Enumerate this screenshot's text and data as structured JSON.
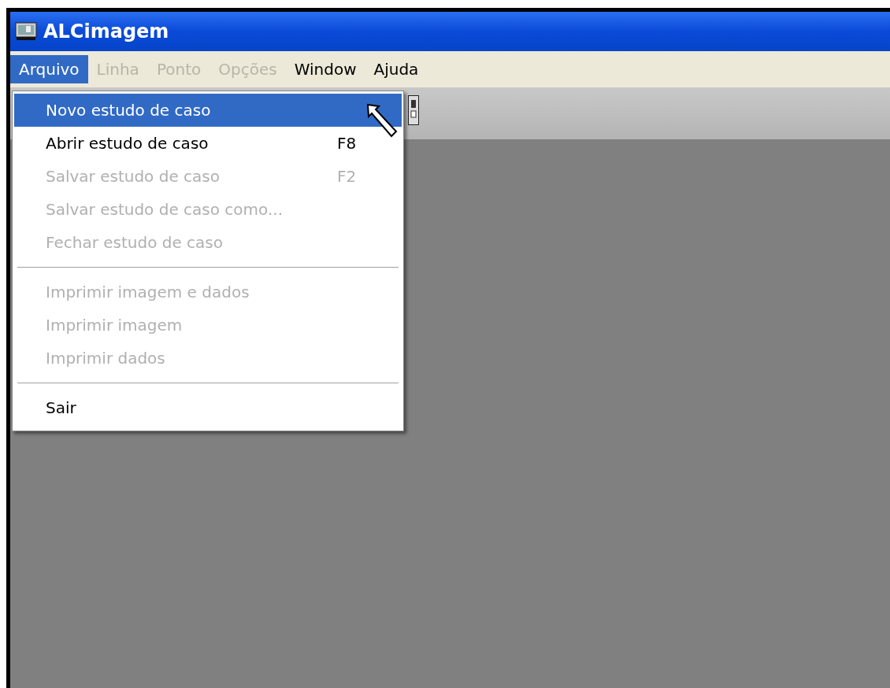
{
  "window": {
    "title": "ALCimagem"
  },
  "menubar": [
    {
      "label": "Arquivo",
      "selected": true,
      "disabled": false
    },
    {
      "label": "Linha",
      "selected": false,
      "disabled": true
    },
    {
      "label": "Ponto",
      "selected": false,
      "disabled": true
    },
    {
      "label": "Opções",
      "selected": false,
      "disabled": true
    },
    {
      "label": "Window",
      "selected": false,
      "disabled": false
    },
    {
      "label": "Ajuda",
      "selected": false,
      "disabled": false
    }
  ],
  "menu": [
    {
      "kind": "item",
      "label": "Novo estudo de caso",
      "selected": true,
      "disabled": false
    },
    {
      "kind": "item",
      "label": "Abrir estudo de caso",
      "shortcut": "F8",
      "selected": false,
      "disabled": false
    },
    {
      "kind": "item",
      "label": "Salvar estudo de caso",
      "shortcut": "F2",
      "selected": false,
      "disabled": true
    },
    {
      "kind": "item",
      "label": "Salvar estudo de caso como...",
      "selected": false,
      "disabled": true
    },
    {
      "kind": "item",
      "label": "Fechar estudo de caso",
      "selected": false,
      "disabled": true
    },
    {
      "kind": "separator"
    },
    {
      "kind": "item",
      "label": "Imprimir imagem e dados",
      "selected": false,
      "disabled": true
    },
    {
      "kind": "item",
      "label": "Imprimir imagem",
      "selected": false,
      "disabled": true
    },
    {
      "kind": "item",
      "label": "Imprimir dados",
      "selected": false,
      "disabled": true
    },
    {
      "kind": "separator"
    },
    {
      "kind": "item",
      "label": "Sair",
      "selected": false,
      "disabled": false
    }
  ]
}
